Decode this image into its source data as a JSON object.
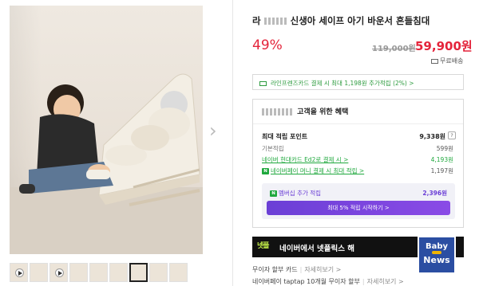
{
  "product": {
    "title": "라 신생아 세이프 아기 바운서 흔들침대",
    "title_masked_prefix": "라",
    "title_suffix": "신생아 세이프 아기 바운서 흔들침대",
    "discount": "49%",
    "original_price": "119,000원",
    "sale_price": "59,900원",
    "shipping": "무료배송"
  },
  "line_banner": "라인프렌즈카드 결제 시 최대 1,198원 추가적립 (2%) >",
  "benefits": {
    "heading": "고객을 위한 혜택",
    "max_points_label": "최대 적립 포인트",
    "max_points_value": "9,338원",
    "help": "?",
    "rows": [
      {
        "label": "기본적립",
        "value": "599원",
        "green": false
      },
      {
        "label": "네이버 현대카드 Ed2로 결제 시 >",
        "value": "4,193원",
        "green": true
      },
      {
        "label": "네이버페이 머니 결제 시 최대 적립 >",
        "value": "1,197원",
        "green": false
      }
    ],
    "npay_icon": "N",
    "membership_label": "멤버십 추가 적립",
    "membership_value": "2,396원",
    "membership_button": "최대 5% 적립 시작하기 >"
  },
  "banner": {
    "logo": "넷플",
    "text": "네이버에서 넷플릭스 해"
  },
  "footer": [
    {
      "label": "무이자 할부 카드",
      "more": "자세히보기 >"
    },
    {
      "label": "네이버페이 taptap 10개월 무이자 할부",
      "more": "자세히보기 >"
    }
  ],
  "watermark": {
    "line1": "Baby",
    "line2": "News"
  },
  "colors": {
    "price_red": "#e4243b",
    "naver_green": "#1fa83d",
    "membership_purple": "#6b3fd6",
    "watermark_blue": "#2b4ea2"
  },
  "icons": [
    "chevron-right-icon",
    "truck-icon",
    "card-icon",
    "help-icon",
    "naverpay-icon",
    "play-icon"
  ]
}
